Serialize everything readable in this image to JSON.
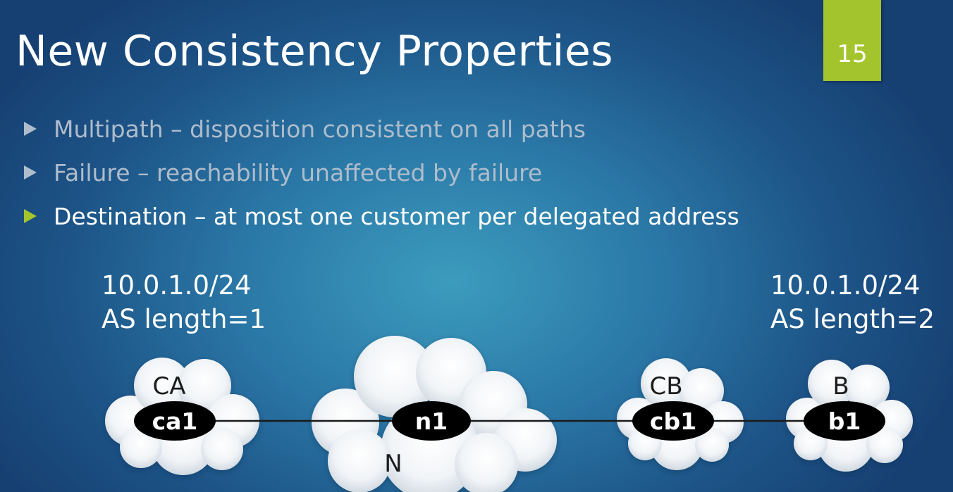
{
  "slide": {
    "title": "New Consistency Properties",
    "number": "15"
  },
  "bullets": [
    {
      "text": "Multipath – disposition consistent on all paths",
      "state": "dim"
    },
    {
      "text": "Failure – reachability unaffected by failure",
      "state": "dim"
    },
    {
      "text": "Destination – at most one customer per delegated address",
      "state": "active"
    }
  ],
  "routes": {
    "left": {
      "prefix": "10.0.1.0/24",
      "as_length": "AS length=1"
    },
    "right": {
      "prefix": "10.0.1.0/24",
      "as_length": "AS length=2"
    }
  },
  "clouds": {
    "ca": {
      "name": "CA",
      "node": "ca1"
    },
    "n": {
      "name": "N",
      "node": "n1"
    },
    "cb": {
      "name": "CB",
      "node": "cb1"
    },
    "b": {
      "name": "B",
      "node": "b1"
    }
  },
  "colors": {
    "accent": "#a3c42c",
    "background": "#2a77a6",
    "bullet_dim": "#aebccb",
    "node_fill": "#000000"
  }
}
